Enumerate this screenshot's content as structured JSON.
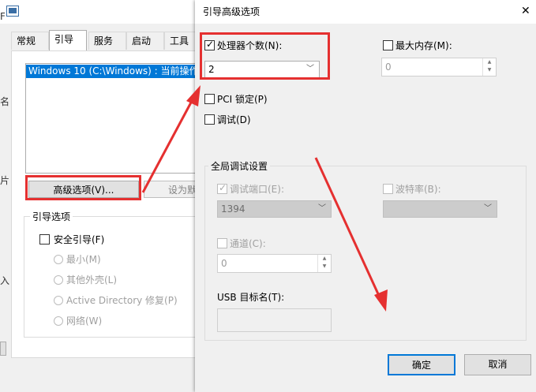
{
  "background_window": {
    "tabs": [
      "常规",
      "引导",
      "服务",
      "启动",
      "工具"
    ],
    "boot_entry": "Windows 10 (C:\\Windows) : 当前操作",
    "advanced_button": "高级选项(V)...",
    "default_button": "设为默",
    "boot_options_group": "引导选项",
    "safe_boot": "安全引导(F)",
    "radio_options": [
      "最小(M)",
      "其他外壳(L)",
      "Active Directory 修复(P)",
      "网络(W)"
    ],
    "edge_chars": [
      "F",
      "名",
      "片",
      "入"
    ]
  },
  "dialog": {
    "title": "引导高级选项",
    "close_glyph": "✕",
    "num_processors_label": "处理器个数(N):",
    "num_processors_value": "2",
    "max_memory_label": "最大内存(M):",
    "max_memory_value": "0",
    "pci_lock_label": "PCI 锁定(P)",
    "debug_label": "调试(D)",
    "global_debug_group": "全局调试设置",
    "debug_port_label": "调试端口(E):",
    "debug_port_value": "1394",
    "baud_rate_label": "波特率(B):",
    "channel_label": "通道(C):",
    "channel_value": "0",
    "usb_target_label": "USB 目标名(T):",
    "ok_button": "确定",
    "cancel_button": "取消"
  },
  "colors": {
    "annotation_red": "#e53030",
    "selection_blue": "#0078d7",
    "ok_button_border": "#0078d7"
  }
}
